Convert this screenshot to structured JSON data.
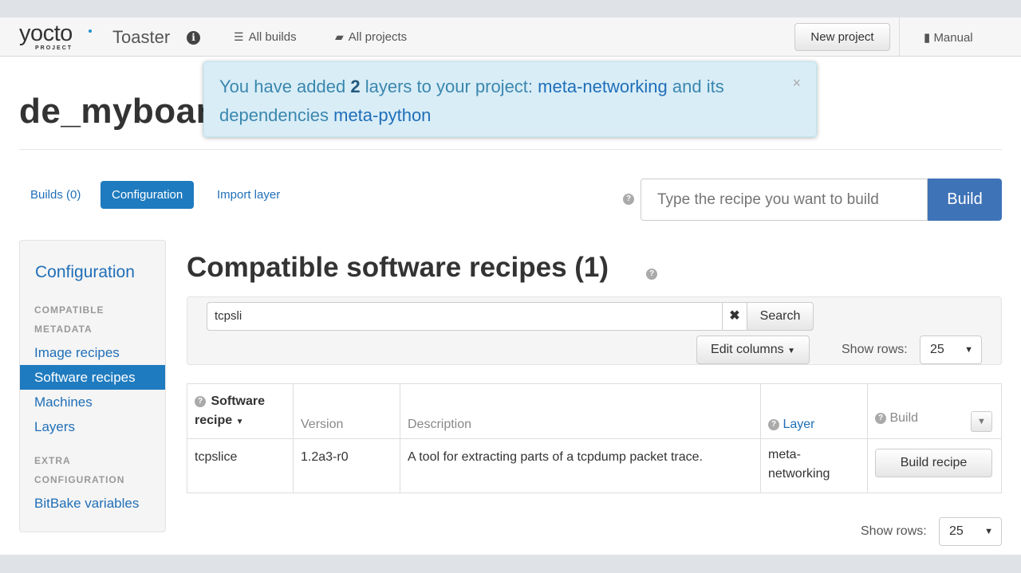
{
  "navbar": {
    "logo_word": "yocto",
    "logo_sub": "PROJECT",
    "app_name": "Toaster",
    "all_builds": "All builds",
    "all_projects": "All projects",
    "new_project": "New project",
    "manual": "Manual"
  },
  "alert": {
    "prefix": "You have added ",
    "count": "2",
    "middle": " layers to your project: ",
    "layer": "meta-networking",
    "and": " and its dependencies ",
    "dependency": "meta-python",
    "close": "×"
  },
  "project": {
    "title": "de_myboard"
  },
  "tabs": {
    "builds": "Builds (0)",
    "configuration": "Configuration",
    "import_layer": "Import layer"
  },
  "build_form": {
    "placeholder": "Type the recipe you want to build",
    "button": "Build"
  },
  "sidebar": {
    "heading": "Configuration",
    "caption_1": "COMPATIBLE METADATA",
    "items_1": [
      "Image recipes",
      "Software recipes",
      "Machines",
      "Layers"
    ],
    "caption_2": "EXTRA CONFIGURATION",
    "items_2": [
      "BitBake variables"
    ]
  },
  "main": {
    "title": "Compatible software recipes (1)",
    "search_value": "tcpsli",
    "clear": "✖",
    "search_button": "Search",
    "edit_columns": "Edit columns",
    "show_rows_label": "Show rows:",
    "show_rows_value": "25"
  },
  "table": {
    "headers": {
      "recipe_line1": "Software",
      "recipe_line2": "recipe",
      "version": "Version",
      "description": "Description",
      "layer": "Layer",
      "build": "Build"
    },
    "rows": [
      {
        "recipe": "tcpslice",
        "version": "1.2a3-r0",
        "description": "A tool for extracting parts of a tcpdump packet trace.",
        "layer_line1": "meta-",
        "layer_line2": "networking",
        "action": "Build recipe"
      }
    ]
  },
  "footer": {
    "show_rows_label": "Show rows:",
    "show_rows_value": "25"
  },
  "colors": {
    "accent": "#1f7bbf",
    "build_button": "#3f73b7",
    "alert_bg": "#d9edf7"
  }
}
